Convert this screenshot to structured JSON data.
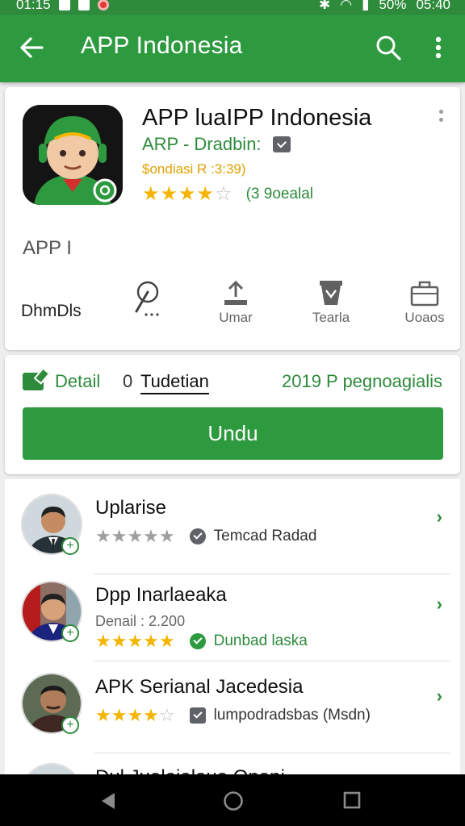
{
  "status_bar": {
    "left_text": "01:15",
    "battery": "50%",
    "time": "05:40"
  },
  "app_bar": {
    "title": "APP Indonesia"
  },
  "app": {
    "name": "APP luaIPP Indonesia",
    "developer": "ARP - Dradbin:",
    "price_line": "$ondiasi R :3:39)",
    "stars": 4,
    "rating_count": "(3 9oealal",
    "short_label": "APP I"
  },
  "actions": {
    "first_label": "DhmDls",
    "items": [
      {
        "label": "",
        "icon": "touch-icon"
      },
      {
        "label": "Umar",
        "icon": "upload-icon"
      },
      {
        "label": "Tearla",
        "icon": "bag-icon"
      },
      {
        "label": "Uoaos",
        "icon": "briefcase-icon"
      }
    ]
  },
  "tabs": {
    "detail": "Detail",
    "num": "0",
    "active": "Tudetian",
    "right": "2019 P pegnoagialis"
  },
  "install_button": "Undu",
  "list": [
    {
      "title": "Uplarise",
      "sub": "",
      "stars": 5,
      "stars_gold": false,
      "meta": "Temcad Radad",
      "meta_green": false
    },
    {
      "title": "Dpp Inarlaeaka",
      "sub": "Denail : 2.200",
      "stars": 5,
      "stars_gold": true,
      "meta": "Dunbad laska",
      "meta_green": true
    },
    {
      "title": "APK Serianal Jacedesia",
      "sub": "",
      "stars": 4,
      "stars_gold": true,
      "meta": "lumpodradsbas (Msdn)",
      "meta_green": false
    },
    {
      "title": "Dul Jualajalaua Opani",
      "sub": "",
      "stars": 0,
      "stars_gold": false,
      "meta": "",
      "meta_green": false
    }
  ],
  "colors": {
    "primary": "#2e9a3f",
    "accent_text": "#2e8b3c",
    "star": "#f4b400",
    "price": "#e0a000"
  }
}
